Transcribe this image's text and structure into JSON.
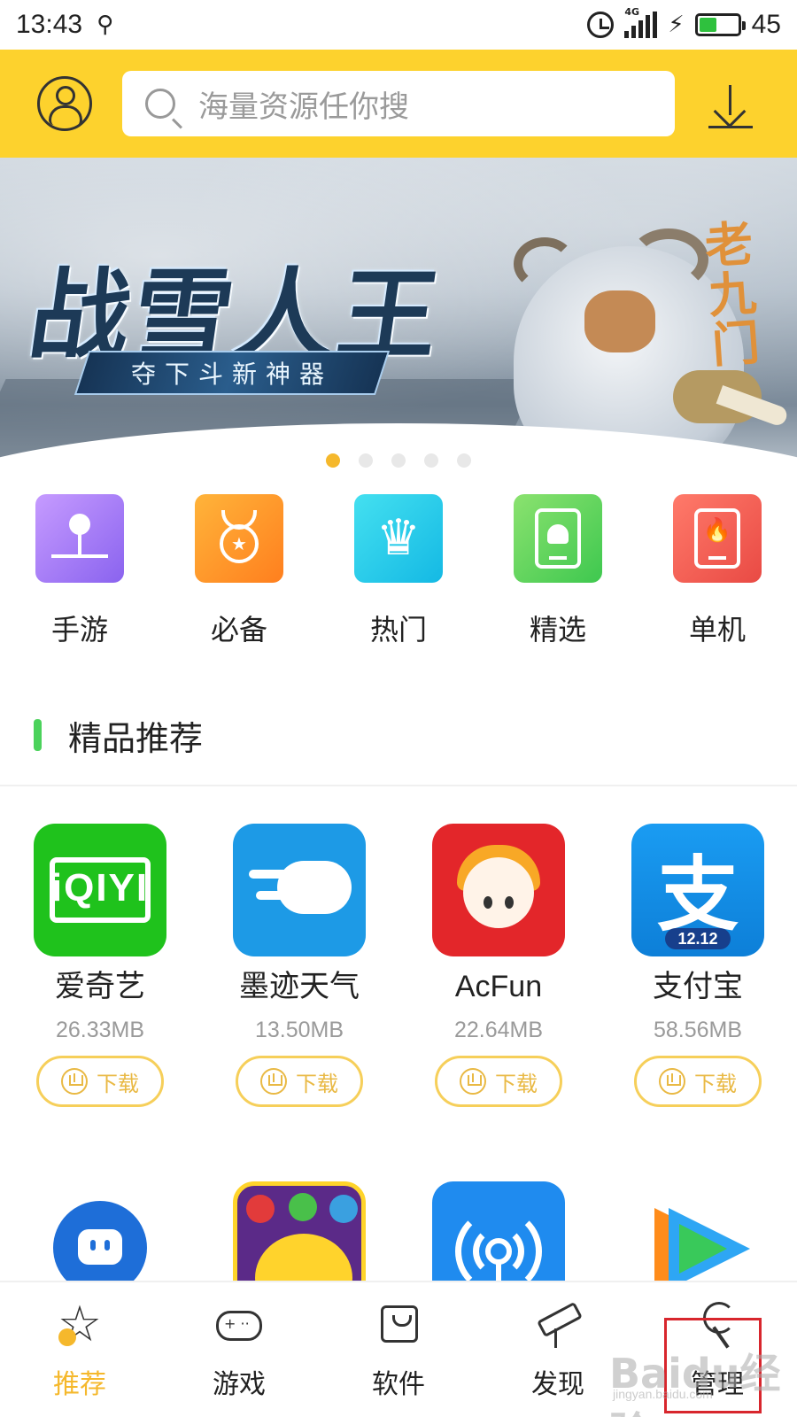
{
  "status_bar": {
    "time": "13:43",
    "network": "4G",
    "battery": "45",
    "battery_fill": 0.45
  },
  "header": {
    "search_placeholder": "海量资源任你搜"
  },
  "banner": {
    "title": "战雪人王",
    "subtitle": "夺下斗新神器",
    "logo": "老九门",
    "active_slide": 0,
    "slide_count": 5
  },
  "categories": [
    {
      "label": "手游",
      "icon": "joystick-icon",
      "color": "#9b76f5"
    },
    {
      "label": "必备",
      "icon": "medal-icon",
      "color": "#ff9a2a"
    },
    {
      "label": "热门",
      "icon": "crown-icon",
      "color": "#2ccbea"
    },
    {
      "label": "精选",
      "icon": "android-icon",
      "color": "#5fd45c"
    },
    {
      "label": "单机",
      "icon": "flame-icon",
      "color": "#ef5a50"
    }
  ],
  "section": {
    "title": "精品推荐",
    "accent_color": "#4bd25b"
  },
  "apps": [
    {
      "name": "爱奇艺",
      "size": "26.33MB",
      "download_label": "下载",
      "icon_text": "iQIYI"
    },
    {
      "name": "墨迹天气",
      "size": "13.50MB",
      "download_label": "下载"
    },
    {
      "name": "AcFun",
      "size": "22.64MB",
      "download_label": "下载"
    },
    {
      "name": "支付宝",
      "size": "58.56MB",
      "download_label": "下载",
      "icon_text": "支",
      "badge": "12.12"
    }
  ],
  "apps_row2": [
    {
      "icon": "chat-bubble-icon"
    },
    {
      "icon": "match-game-icon"
    },
    {
      "icon": "wifi-key-icon"
    },
    {
      "icon": "video-play-icon"
    }
  ],
  "bottom_nav": [
    {
      "label": "推荐",
      "icon": "star-icon",
      "active": true
    },
    {
      "label": "游戏",
      "icon": "gamepad-icon",
      "active": false
    },
    {
      "label": "软件",
      "icon": "bag-icon",
      "active": false
    },
    {
      "label": "发现",
      "icon": "telescope-icon",
      "active": false
    },
    {
      "label": "管理",
      "icon": "wrench-icon",
      "active": false
    }
  ],
  "colors": {
    "brand_yellow": "#fdd22d",
    "accent_orange": "#f5b82c",
    "download_border": "#f6cf5a",
    "highlight_red": "#d8262d"
  },
  "watermark": {
    "text": "Baidu经验",
    "sub": "jingyan.baidu.com"
  }
}
